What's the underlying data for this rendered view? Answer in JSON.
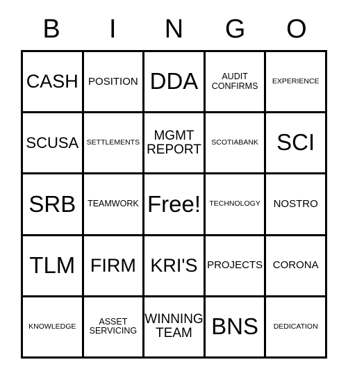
{
  "card": {
    "title": "BINGO",
    "header": {
      "letters": [
        "B",
        "I",
        "N",
        "G",
        "O"
      ]
    },
    "colors": {
      "background": "#ffffff",
      "text": "#000000",
      "border": "#000000"
    },
    "grid": {
      "rows": 5,
      "columns": 5,
      "free_space": {
        "row": 2,
        "column": 2,
        "label": "Free!"
      },
      "cells": [
        [
          {
            "label": "CASH",
            "size": "xl"
          },
          {
            "label": "POSITION",
            "size": "s"
          },
          {
            "label": "DDA",
            "size": "xxl"
          },
          {
            "label": "AUDIT\nCONFIRMS",
            "size": "xs"
          },
          {
            "label": "EXPERIENCE",
            "size": "xxs"
          }
        ],
        [
          {
            "label": "SCUSA",
            "size": "l"
          },
          {
            "label": "SETTLEMENTS",
            "size": "xxs"
          },
          {
            "label": "MGMT\nREPORT",
            "size": "m"
          },
          {
            "label": "SCOTIABANK",
            "size": "xxs"
          },
          {
            "label": "SCI",
            "size": "xxl"
          }
        ],
        [
          {
            "label": "SRB",
            "size": "xxl"
          },
          {
            "label": "TEAMWORK",
            "size": "xs"
          },
          {
            "label": "Free!",
            "size": "xxl"
          },
          {
            "label": "TECHNOLOGY",
            "size": "xxs"
          },
          {
            "label": "NOSTRO",
            "size": "s"
          }
        ],
        [
          {
            "label": "TLM",
            "size": "xxl"
          },
          {
            "label": "FIRM",
            "size": "xl"
          },
          {
            "label": "KRI'S",
            "size": "xl"
          },
          {
            "label": "PROJECTS",
            "size": "s"
          },
          {
            "label": "CORONA",
            "size": "s"
          }
        ],
        [
          {
            "label": "KNOWLEDGE",
            "size": "xxs"
          },
          {
            "label": "ASSET\nSERVICING",
            "size": "xs"
          },
          {
            "label": "WINNING\nTEAM",
            "size": "m"
          },
          {
            "label": "BNS",
            "size": "xxl"
          },
          {
            "label": "DEDICATION",
            "size": "xxs"
          }
        ]
      ]
    }
  }
}
